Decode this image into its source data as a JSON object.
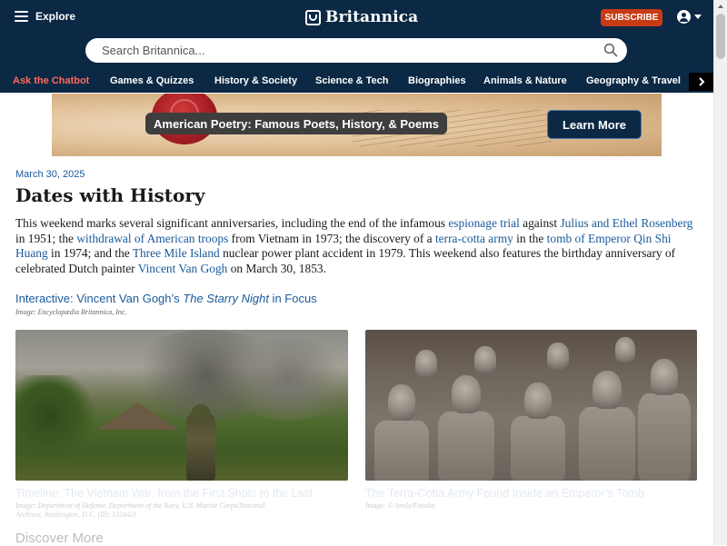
{
  "header": {
    "explore_label": "Explore",
    "logo_text": "Britannica",
    "subscribe_label": "SUBSCRIBE"
  },
  "search": {
    "placeholder": "Search Britannica..."
  },
  "nav": {
    "items": [
      {
        "label": "Ask the Chatbot"
      },
      {
        "label": "Games & Quizzes"
      },
      {
        "label": "History & Society"
      },
      {
        "label": "Science & Tech"
      },
      {
        "label": "Biographies"
      },
      {
        "label": "Animals & Nature"
      },
      {
        "label": "Geography & Travel"
      }
    ]
  },
  "banner": {
    "text": "American Poetry: Famous Poets, History, & Poems",
    "button_label": "Learn More"
  },
  "article": {
    "date": "March 30, 2025",
    "title": "Dates with History",
    "body": {
      "t1": "This weekend marks several significant anniversaries, including the end of the infamous ",
      "l1": "espionage trial",
      "t2": " against ",
      "l2": "Julius and Ethel Rosenberg",
      "t3": " in 1951; the ",
      "l3": "withdrawal of American troops",
      "t4": " from Vietnam in 1973; the discovery of a ",
      "l4": "terra-cotta army",
      "t5": " in the ",
      "l5": "tomb of Emperor Qin Shi Huang",
      "t6": " in 1974; and the ",
      "l6": "Three Mile Island",
      "t7": " nuclear power plant accident in 1979. This weekend also features the birthday anniversary of celebrated Dutch painter ",
      "l7": "Vincent Van Gogh",
      "t8": " on March 30, 1853."
    }
  },
  "interactive": {
    "prefix": "Interactive: Vincent Van Gogh’s ",
    "italic": "The Starry Night",
    "suffix": " in Focus",
    "credit": "Image: Encyclopædia Britannica, Inc."
  },
  "cards": [
    {
      "caption": "Timeline: The Vietnam War, from the First Shots to the Last",
      "credit_line1": "Image: Department of Defense, Department of the Navy, U.S. Marine Corps/National",
      "credit_line2": "Archives, Washington, D.C. (ID: 532442)"
    },
    {
      "caption": "The Terra-Cotta Army Found Inside an Emperor’s Tomb",
      "credit_line1": "Image: © lenily/Fotolia"
    }
  ],
  "discover": {
    "label": "Discover More"
  },
  "colors": {
    "header_bg": "#0b2844",
    "link": "#1a5a9a",
    "subscribe_bg": "#c73b14",
    "chatbot_accent": "#ff6b5a"
  }
}
